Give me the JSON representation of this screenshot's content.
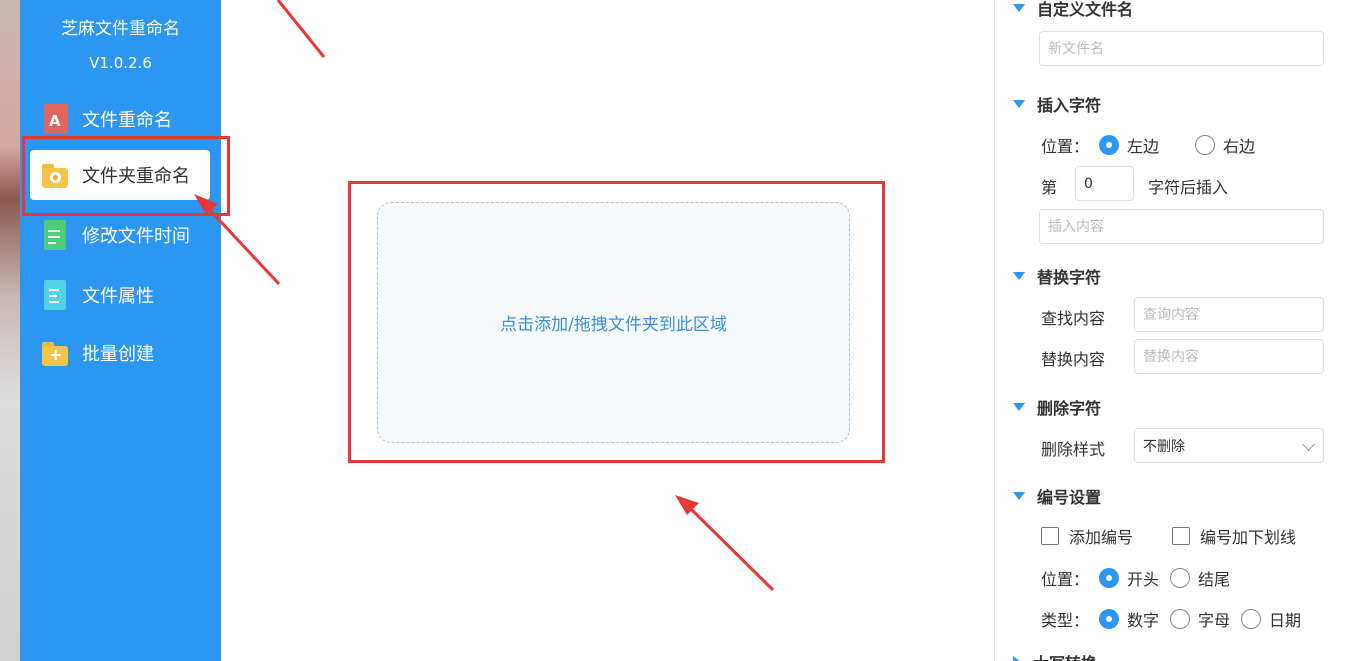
{
  "app": {
    "title": "芝麻文件重命名",
    "version": "V1.0.2.6"
  },
  "sidebar": {
    "items": [
      {
        "label": "文件重命名",
        "icon": "file-rename-icon",
        "active": false
      },
      {
        "label": "文件夹重命名",
        "icon": "folder-rename-icon",
        "active": true
      },
      {
        "label": "修改文件时间",
        "icon": "file-time-icon",
        "active": false
      },
      {
        "label": "文件属性",
        "icon": "file-attribute-icon",
        "active": false
      },
      {
        "label": "批量创建",
        "icon": "batch-create-icon",
        "active": false
      }
    ],
    "color": "#2c97f2"
  },
  "main": {
    "drop_text": "点击添加/拖拽文件夹到此区域"
  },
  "panel": {
    "custom_name": {
      "title": "自定义文件名",
      "placeholder": "新文件名"
    },
    "insert": {
      "title": "插入字符",
      "position_label": "位置：",
      "left": "左边",
      "right": "右边",
      "nth_prefix": "第",
      "nth_value": "0",
      "nth_suffix": "字符后插入",
      "content_placeholder": "插入内容"
    },
    "replace": {
      "title": "替换字符",
      "find_label": "查找内容",
      "find_placeholder": "查询内容",
      "replace_label": "替换内容",
      "replace_placeholder": "替换内容"
    },
    "delete": {
      "title": "删除字符",
      "style_label": "删除样式",
      "style_value": "不删除"
    },
    "numbering": {
      "title": "编号设置",
      "add_number": "添加编号",
      "underline": "编号加下划线",
      "position_label": "位置：",
      "start": "开头",
      "end": "结尾",
      "type_label": "类型：",
      "digit": "数字",
      "letter": "字母",
      "date": "日期"
    },
    "next_section_title": "大写转换"
  },
  "colors": {
    "accent": "#2c97f2",
    "annotation": "#e53935"
  }
}
